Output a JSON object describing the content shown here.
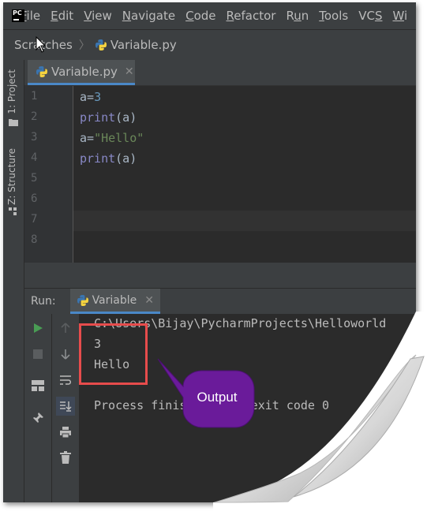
{
  "app": {
    "logo_text": "PC"
  },
  "menu": {
    "items": [
      {
        "pre": "",
        "u": "F",
        "post": "ile"
      },
      {
        "pre": "",
        "u": "E",
        "post": "dit"
      },
      {
        "pre": "",
        "u": "V",
        "post": "iew"
      },
      {
        "pre": "",
        "u": "N",
        "post": "avigate"
      },
      {
        "pre": "",
        "u": "C",
        "post": "ode"
      },
      {
        "pre": "",
        "u": "R",
        "post": "efactor"
      },
      {
        "pre": "R",
        "u": "u",
        "post": "n"
      },
      {
        "pre": "",
        "u": "T",
        "post": "ools"
      },
      {
        "pre": "VC",
        "u": "S",
        "post": ""
      },
      {
        "pre": "",
        "u": "W",
        "post": "i"
      }
    ]
  },
  "breadcrumb": {
    "root": "Scratches",
    "file": "Variable.py"
  },
  "tool_windows": {
    "project": "1: Project",
    "structure": "Z: Structure"
  },
  "editor": {
    "tab_label": "Variable.py",
    "line_numbers": [
      "1",
      "2",
      "3",
      "4",
      "5",
      "6",
      "7",
      "8"
    ],
    "lines": [
      [
        {
          "t": "a=",
          "c": "plain"
        },
        {
          "t": "3",
          "c": "num"
        }
      ],
      [
        {
          "t": "print",
          "c": "fn"
        },
        {
          "t": "(a)",
          "c": "plain"
        }
      ],
      [
        {
          "t": "a=",
          "c": "plain"
        },
        {
          "t": "\"Hello\"",
          "c": "str"
        }
      ],
      [
        {
          "t": "print",
          "c": "fn"
        },
        {
          "t": "(a)",
          "c": "plain"
        }
      ]
    ]
  },
  "run": {
    "label": "Run:",
    "tab_label": "Variable",
    "console_lines": [
      "C:\\Users\\Bijay\\PycharmProjects\\Helloworld",
      "3",
      "Hello",
      "",
      "Process finished with exit code 0"
    ]
  },
  "annotation": {
    "callout_text": "Output",
    "callout_color": "#6a1b9a",
    "box_color": "#e74c4c"
  }
}
